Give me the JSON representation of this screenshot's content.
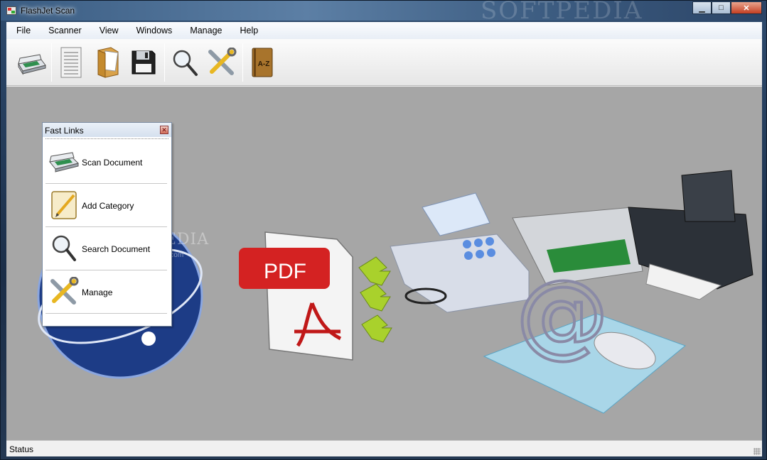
{
  "window": {
    "title": "FlashJet Scan",
    "background_watermark": "SOFTPEDIA"
  },
  "menu": [
    "File",
    "Scanner",
    "View",
    "Windows",
    "Manage",
    "Help"
  ],
  "toolbar": {
    "buttons": [
      "scanner-icon",
      "document-icon",
      "folder-icon",
      "floppy-save-icon",
      "magnifier-icon",
      "tools-icon",
      "az-book-icon"
    ]
  },
  "fast_links": {
    "title": "Fast Links",
    "items": [
      {
        "label": "Scan Document",
        "icon": "scanner-icon"
      },
      {
        "label": "Add Category",
        "icon": "notepad-pencil-icon"
      },
      {
        "label": "Search Document",
        "icon": "magnifier-icon"
      },
      {
        "label": "Manage",
        "icon": "tools-icon"
      }
    ]
  },
  "splash": {
    "pdf_label": "PDF",
    "at_symbol": "@"
  },
  "watermark": {
    "text": "SOFTPEDIA",
    "url": "www.softpedia.com"
  },
  "status": {
    "text": "Status"
  }
}
